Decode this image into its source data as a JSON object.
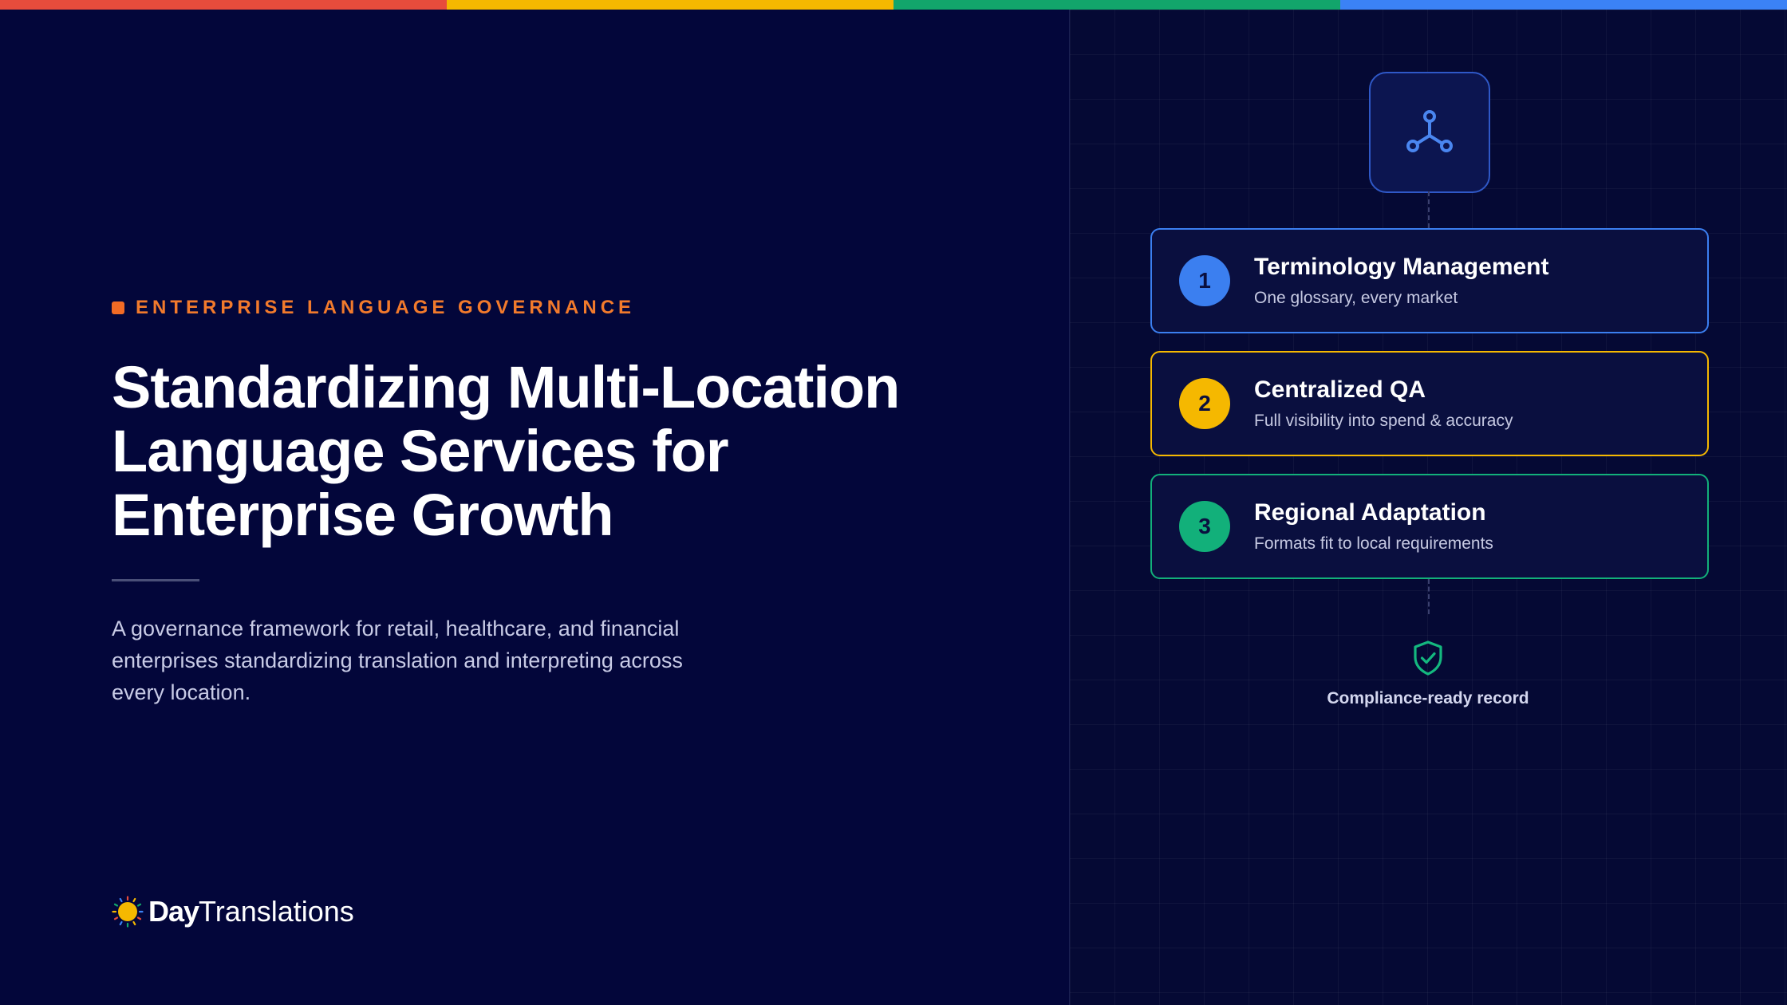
{
  "top_bar": {
    "colors": [
      "#e74c3c",
      "#f5b800",
      "#12a56b",
      "#3b82f6"
    ]
  },
  "hero": {
    "eyebrow": "ENTERPRISE LANGUAGE GOVERNANCE",
    "title_lines": [
      "Standardizing Multi-Location",
      "Language Services for",
      "Enterprise Growth"
    ],
    "description_lines": [
      "A governance framework for retail, healthcare, and financial",
      "enterprises standardizing translation and interpreting across",
      "every location."
    ]
  },
  "logo": {
    "day": "Day",
    "translations": "Translations"
  },
  "diagram": {
    "hub_icon": "hub-network-icon",
    "steps": [
      {
        "number": "1",
        "title": "Terminology Management",
        "subtitle": "One glossary, every market",
        "color": "#3b7ff0"
      },
      {
        "number": "2",
        "title": "Centralized QA",
        "subtitle": "Full visibility into spend & accuracy",
        "color": "#f5b800"
      },
      {
        "number": "3",
        "title": "Regional Adaptation",
        "subtitle": "Formats fit to local requirements",
        "color": "#12b07a"
      }
    ],
    "result_icon": "shield-check-icon",
    "result_label": "Compliance-ready record"
  }
}
